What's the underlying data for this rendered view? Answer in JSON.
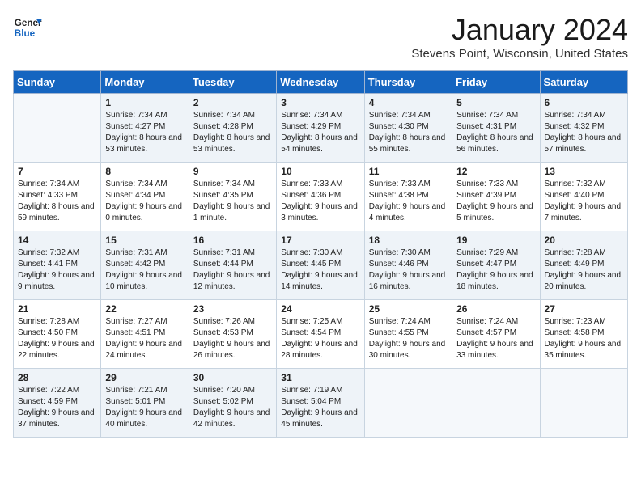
{
  "logo": {
    "general": "General",
    "blue": "Blue"
  },
  "title": "January 2024",
  "location": "Stevens Point, Wisconsin, United States",
  "days_of_week": [
    "Sunday",
    "Monday",
    "Tuesday",
    "Wednesday",
    "Thursday",
    "Friday",
    "Saturday"
  ],
  "weeks": [
    [
      {
        "num": "",
        "sunrise": "",
        "sunset": "",
        "daylight": ""
      },
      {
        "num": "1",
        "sunrise": "Sunrise: 7:34 AM",
        "sunset": "Sunset: 4:27 PM",
        "daylight": "Daylight: 8 hours and 53 minutes."
      },
      {
        "num": "2",
        "sunrise": "Sunrise: 7:34 AM",
        "sunset": "Sunset: 4:28 PM",
        "daylight": "Daylight: 8 hours and 53 minutes."
      },
      {
        "num": "3",
        "sunrise": "Sunrise: 7:34 AM",
        "sunset": "Sunset: 4:29 PM",
        "daylight": "Daylight: 8 hours and 54 minutes."
      },
      {
        "num": "4",
        "sunrise": "Sunrise: 7:34 AM",
        "sunset": "Sunset: 4:30 PM",
        "daylight": "Daylight: 8 hours and 55 minutes."
      },
      {
        "num": "5",
        "sunrise": "Sunrise: 7:34 AM",
        "sunset": "Sunset: 4:31 PM",
        "daylight": "Daylight: 8 hours and 56 minutes."
      },
      {
        "num": "6",
        "sunrise": "Sunrise: 7:34 AM",
        "sunset": "Sunset: 4:32 PM",
        "daylight": "Daylight: 8 hours and 57 minutes."
      }
    ],
    [
      {
        "num": "7",
        "sunrise": "Sunrise: 7:34 AM",
        "sunset": "Sunset: 4:33 PM",
        "daylight": "Daylight: 8 hours and 59 minutes."
      },
      {
        "num": "8",
        "sunrise": "Sunrise: 7:34 AM",
        "sunset": "Sunset: 4:34 PM",
        "daylight": "Daylight: 9 hours and 0 minutes."
      },
      {
        "num": "9",
        "sunrise": "Sunrise: 7:34 AM",
        "sunset": "Sunset: 4:35 PM",
        "daylight": "Daylight: 9 hours and 1 minute."
      },
      {
        "num": "10",
        "sunrise": "Sunrise: 7:33 AM",
        "sunset": "Sunset: 4:36 PM",
        "daylight": "Daylight: 9 hours and 3 minutes."
      },
      {
        "num": "11",
        "sunrise": "Sunrise: 7:33 AM",
        "sunset": "Sunset: 4:38 PM",
        "daylight": "Daylight: 9 hours and 4 minutes."
      },
      {
        "num": "12",
        "sunrise": "Sunrise: 7:33 AM",
        "sunset": "Sunset: 4:39 PM",
        "daylight": "Daylight: 9 hours and 5 minutes."
      },
      {
        "num": "13",
        "sunrise": "Sunrise: 7:32 AM",
        "sunset": "Sunset: 4:40 PM",
        "daylight": "Daylight: 9 hours and 7 minutes."
      }
    ],
    [
      {
        "num": "14",
        "sunrise": "Sunrise: 7:32 AM",
        "sunset": "Sunset: 4:41 PM",
        "daylight": "Daylight: 9 hours and 9 minutes."
      },
      {
        "num": "15",
        "sunrise": "Sunrise: 7:31 AM",
        "sunset": "Sunset: 4:42 PM",
        "daylight": "Daylight: 9 hours and 10 minutes."
      },
      {
        "num": "16",
        "sunrise": "Sunrise: 7:31 AM",
        "sunset": "Sunset: 4:44 PM",
        "daylight": "Daylight: 9 hours and 12 minutes."
      },
      {
        "num": "17",
        "sunrise": "Sunrise: 7:30 AM",
        "sunset": "Sunset: 4:45 PM",
        "daylight": "Daylight: 9 hours and 14 minutes."
      },
      {
        "num": "18",
        "sunrise": "Sunrise: 7:30 AM",
        "sunset": "Sunset: 4:46 PM",
        "daylight": "Daylight: 9 hours and 16 minutes."
      },
      {
        "num": "19",
        "sunrise": "Sunrise: 7:29 AM",
        "sunset": "Sunset: 4:47 PM",
        "daylight": "Daylight: 9 hours and 18 minutes."
      },
      {
        "num": "20",
        "sunrise": "Sunrise: 7:28 AM",
        "sunset": "Sunset: 4:49 PM",
        "daylight": "Daylight: 9 hours and 20 minutes."
      }
    ],
    [
      {
        "num": "21",
        "sunrise": "Sunrise: 7:28 AM",
        "sunset": "Sunset: 4:50 PM",
        "daylight": "Daylight: 9 hours and 22 minutes."
      },
      {
        "num": "22",
        "sunrise": "Sunrise: 7:27 AM",
        "sunset": "Sunset: 4:51 PM",
        "daylight": "Daylight: 9 hours and 24 minutes."
      },
      {
        "num": "23",
        "sunrise": "Sunrise: 7:26 AM",
        "sunset": "Sunset: 4:53 PM",
        "daylight": "Daylight: 9 hours and 26 minutes."
      },
      {
        "num": "24",
        "sunrise": "Sunrise: 7:25 AM",
        "sunset": "Sunset: 4:54 PM",
        "daylight": "Daylight: 9 hours and 28 minutes."
      },
      {
        "num": "25",
        "sunrise": "Sunrise: 7:24 AM",
        "sunset": "Sunset: 4:55 PM",
        "daylight": "Daylight: 9 hours and 30 minutes."
      },
      {
        "num": "26",
        "sunrise": "Sunrise: 7:24 AM",
        "sunset": "Sunset: 4:57 PM",
        "daylight": "Daylight: 9 hours and 33 minutes."
      },
      {
        "num": "27",
        "sunrise": "Sunrise: 7:23 AM",
        "sunset": "Sunset: 4:58 PM",
        "daylight": "Daylight: 9 hours and 35 minutes."
      }
    ],
    [
      {
        "num": "28",
        "sunrise": "Sunrise: 7:22 AM",
        "sunset": "Sunset: 4:59 PM",
        "daylight": "Daylight: 9 hours and 37 minutes."
      },
      {
        "num": "29",
        "sunrise": "Sunrise: 7:21 AM",
        "sunset": "Sunset: 5:01 PM",
        "daylight": "Daylight: 9 hours and 40 minutes."
      },
      {
        "num": "30",
        "sunrise": "Sunrise: 7:20 AM",
        "sunset": "Sunset: 5:02 PM",
        "daylight": "Daylight: 9 hours and 42 minutes."
      },
      {
        "num": "31",
        "sunrise": "Sunrise: 7:19 AM",
        "sunset": "Sunset: 5:04 PM",
        "daylight": "Daylight: 9 hours and 45 minutes."
      },
      {
        "num": "",
        "sunrise": "",
        "sunset": "",
        "daylight": ""
      },
      {
        "num": "",
        "sunrise": "",
        "sunset": "",
        "daylight": ""
      },
      {
        "num": "",
        "sunrise": "",
        "sunset": "",
        "daylight": ""
      }
    ]
  ]
}
